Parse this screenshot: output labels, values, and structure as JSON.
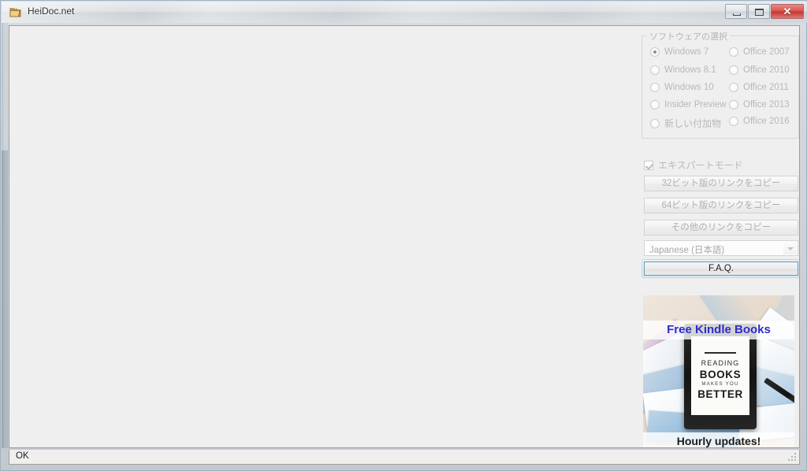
{
  "window": {
    "title": "HeiDoc.net",
    "icon": "folder-icon",
    "controls": {
      "minimize": "minimize-icon",
      "maximize": "maximize-icon",
      "close": "✕"
    }
  },
  "software_group": {
    "label": "ソフトウェアの選択",
    "options": [
      {
        "label": "Windows 7",
        "checked": true,
        "enabled": false
      },
      {
        "label": "Windows 8.1",
        "checked": false,
        "enabled": false
      },
      {
        "label": "Windows 10",
        "checked": false,
        "enabled": false
      },
      {
        "label": "Insider Preview",
        "checked": false,
        "enabled": false
      },
      {
        "label": "新しい付加物",
        "checked": false,
        "enabled": false
      },
      {
        "label": "Office 2007",
        "checked": false,
        "enabled": false
      },
      {
        "label": "Office 2010",
        "checked": false,
        "enabled": false
      },
      {
        "label": "Office 2011",
        "checked": false,
        "enabled": false
      },
      {
        "label": "Office 2013",
        "checked": false,
        "enabled": false
      },
      {
        "label": "Office 2016",
        "checked": false,
        "enabled": false
      }
    ]
  },
  "expert_mode": {
    "label": "エキスパートモード",
    "checked": true,
    "enabled": false
  },
  "buttons": {
    "copy_32": "32ビット版のリンクをコピー",
    "copy_64": "64ビット版のリンクをコピー",
    "copy_other": "その他のリンクをコピー",
    "faq": "F.A.Q."
  },
  "language": {
    "selected": "Japanese (日本語)",
    "arrow": "chevron-down-icon"
  },
  "advertisement": {
    "headline": "Free Kindle Books",
    "device_text": {
      "line1": "READING",
      "line2": "BOOKS",
      "line3": "MAKES YOU",
      "line4": "BETTER"
    },
    "footer": "Hourly updates!"
  },
  "status": {
    "text": "OK"
  },
  "colors": {
    "accent_focus": "#6e97ad",
    "ad_headline": "#2d2dc8",
    "close_button": "#c0332c",
    "panel_bg": "#efefef"
  }
}
